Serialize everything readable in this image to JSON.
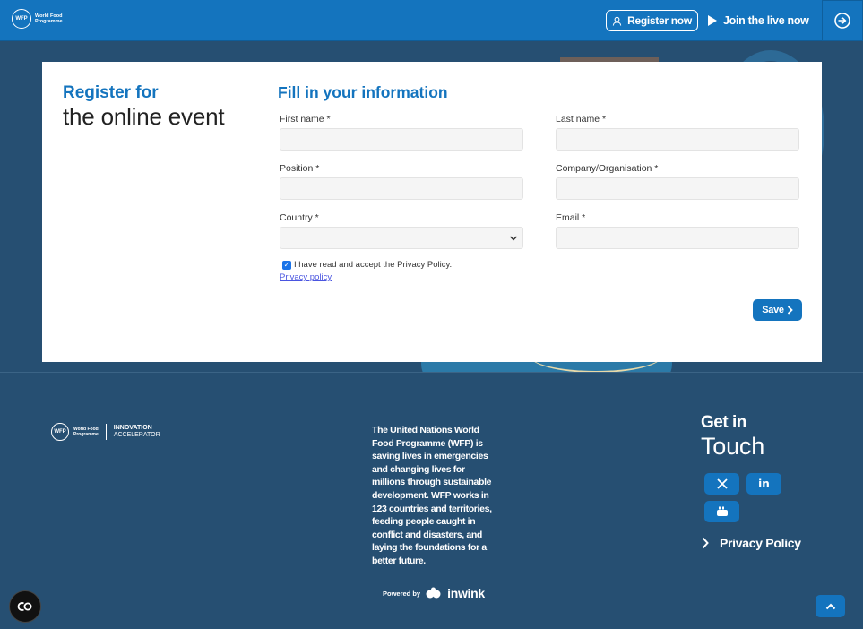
{
  "header": {
    "logo_line1": "WFP",
    "logo_line2": "World Food",
    "logo_line3": "Programme",
    "register_label": "Register now",
    "live_label": "Join the live now"
  },
  "form": {
    "register_title": "Register for",
    "register_subtitle": "the online event",
    "fill_title": "Fill in your information",
    "fields": {
      "first_name": "First name *",
      "last_name": "Last name *",
      "position": "Position *",
      "company": "Company/Organisation *",
      "country": "Country *",
      "email": "Email *"
    },
    "consent_text": "I have read and accept the Privacy Policy.",
    "consent_checked": true,
    "privacy_link": "Privacy policy",
    "save_label": "Save"
  },
  "footer": {
    "logo_wfp": "WFP",
    "logo_name_line1": "World Food",
    "logo_name_line2": "Programme",
    "innovation_line1": "INNOVATION",
    "innovation_line2": "ACCELERATOR",
    "about": "The United Nations World Food Programme (WFP) is saving lives in emergencies and changing lives for millions through sustainable development. WFP works in 123 countries and territories, feeding people caught in conflict and disasters, and laying the foundations for a better future.",
    "powered_by": "Powered by",
    "powered_brand": "inwink",
    "get_in": "Get in",
    "touch": "Touch",
    "social": [
      "x-icon",
      "linkedin-icon",
      "youtube-icon"
    ],
    "privacy_policy": "Privacy Policy"
  },
  "colors": {
    "accent": "#1474be",
    "background": "#264f72"
  }
}
